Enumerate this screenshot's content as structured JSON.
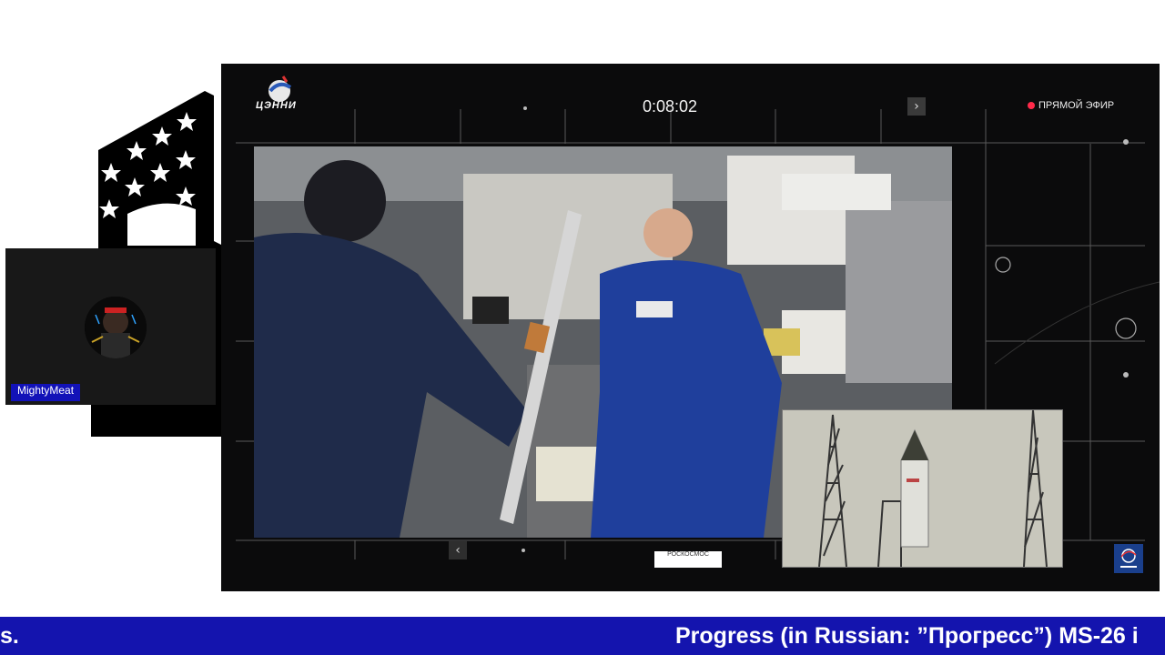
{
  "webcam": {
    "username": "MightyMeat"
  },
  "broadcast": {
    "timer": "0:08:02",
    "live_label": "ПРЯМОЙ ЭФИР",
    "brand": "ЦЭННИ",
    "caption": "РОСКОСМОС",
    "live_color": "#ff2a4a"
  },
  "ticker": {
    "left_text": "s.",
    "right_text": "Progress (in Russian: ”Прогресс”) MS-26 i",
    "background": "#1414ae"
  },
  "icons": [
    "flag-stars-icon",
    "chevron-right-icon",
    "chevron-left-icon",
    "live-dot-icon",
    "agency-logo-icon"
  ]
}
